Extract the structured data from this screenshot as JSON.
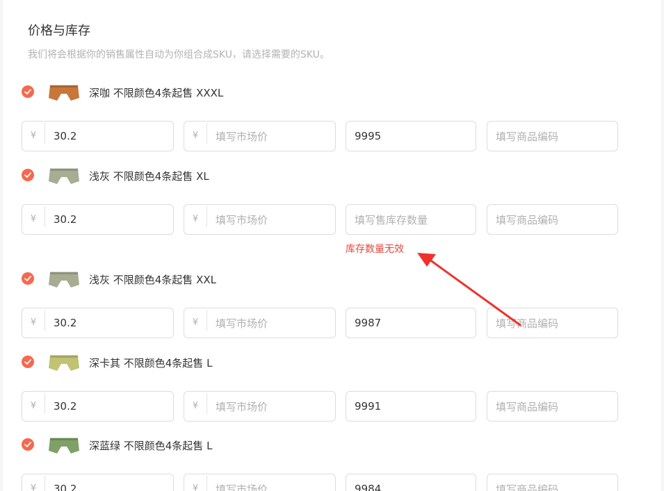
{
  "section": {
    "title": "价格与库存",
    "subtitle": "我们将会根据你的销售属性自动为你组合成SKU，请选择需要的SKU。"
  },
  "currency_symbol": "¥",
  "placeholders": {
    "market_price": "填写市场价",
    "stock": "填写售库存数量",
    "code": "填写商品编码"
  },
  "error_text": "库存数量无效",
  "skus": [
    {
      "name": "深咖 不限颜色4条起售 XXXL",
      "price": "30.2",
      "stock": "9995",
      "color": "#c8763a"
    },
    {
      "name": "浅灰 不限颜色4条起售 XL",
      "price": "30.2",
      "stock": "",
      "color": "#a7ad92"
    },
    {
      "name": "浅灰 不限颜色4条起售 XXL",
      "price": "30.2",
      "stock": "9987",
      "color": "#a7ad92"
    },
    {
      "name": "深卡其 不限颜色4条起售 L",
      "price": "30.2",
      "stock": "9991",
      "color": "#c1c272"
    },
    {
      "name": "深蓝绿 不限颜色4条起售 L",
      "price": "30.2",
      "stock": "9984",
      "color": "#7fa067"
    }
  ],
  "annotation_color": "#f0302a"
}
